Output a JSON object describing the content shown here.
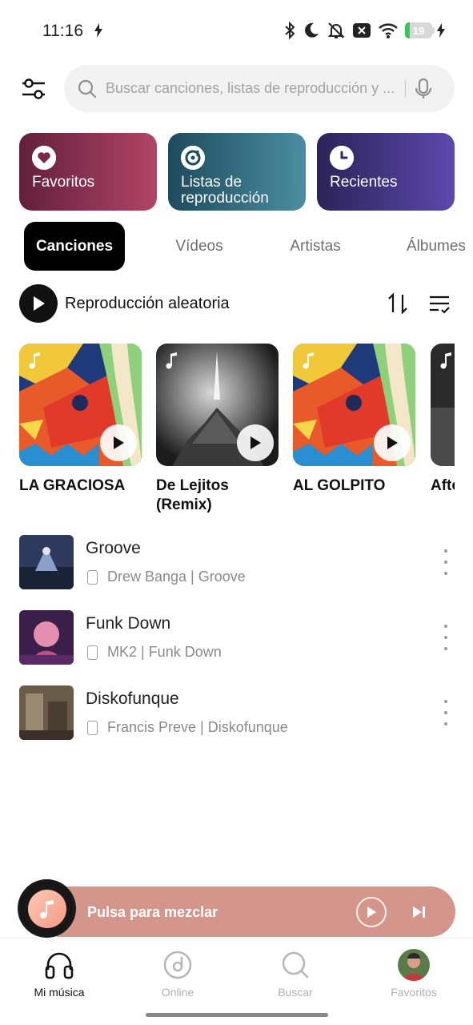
{
  "status_bar": {
    "time": "11:16",
    "battery": "19"
  },
  "search": {
    "placeholder": "Buscar canciones, listas de reproducción y ..."
  },
  "quick_cards": [
    {
      "label": "Favoritos",
      "icon": "heart-icon"
    },
    {
      "label": "Listas de reproducción",
      "icon": "playlist-disc-icon"
    },
    {
      "label": "Recientes",
      "icon": "clock-icon"
    }
  ],
  "tabs": [
    "Canciones",
    "Vídeos",
    "Artistas",
    "Álbumes"
  ],
  "shuffle": {
    "label": "Reproducción aleatoria"
  },
  "carousel": [
    {
      "title": "LA GRACIOSA"
    },
    {
      "title": "De Lejitos (Remix)"
    },
    {
      "title": "AL GOLPITO"
    },
    {
      "title": "Afterparty"
    }
  ],
  "songs": [
    {
      "title": "Groove",
      "subtitle": "Drew Banga | Groove"
    },
    {
      "title": "Funk Down",
      "subtitle": "MK2 | Funk Down"
    },
    {
      "title": "Diskofunque",
      "subtitle": "Francis Preve | Diskofunque"
    }
  ],
  "mini_player": {
    "label": "Pulsa para mezclar",
    "color": "#d4968a"
  },
  "bottom_nav": [
    {
      "label": "Mi música",
      "icon": "headphones-icon",
      "active": true
    },
    {
      "label": "Online",
      "icon": "disc-icon",
      "active": false
    },
    {
      "label": "Buscar",
      "icon": "search-icon",
      "active": false
    },
    {
      "label": "Favoritos",
      "icon": "avatar",
      "active": false
    }
  ]
}
